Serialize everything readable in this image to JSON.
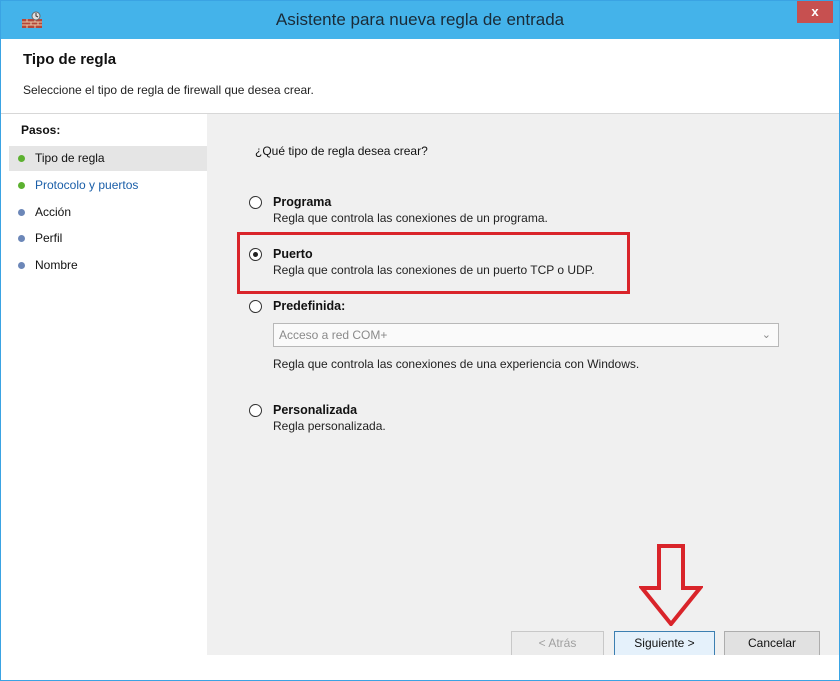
{
  "window": {
    "title": "Asistente para nueva regla de entrada",
    "close_label": "x",
    "app_icon": "firewall-wall-icon"
  },
  "header": {
    "title": "Tipo de regla",
    "subtitle": "Seleccione el tipo de regla de firewall que desea crear."
  },
  "steps": {
    "heading": "Pasos:",
    "items": [
      {
        "label": "Tipo de regla",
        "status": "green"
      },
      {
        "label": "Protocolo y puertos",
        "status": "green"
      },
      {
        "label": "Acción",
        "status": "blue"
      },
      {
        "label": "Perfil",
        "status": "blue"
      },
      {
        "label": "Nombre",
        "status": "blue"
      }
    ]
  },
  "content": {
    "question": "¿Qué tipo de regla desea crear?",
    "options": [
      {
        "title": "Programa",
        "description": "Regla que controla las conexiones de un programa.",
        "checked": false
      },
      {
        "title": "Puerto",
        "description": "Regla que controla las conexiones de un puerto TCP o UDP.",
        "checked": true
      },
      {
        "title": "Predefinida:",
        "description": "",
        "checked": false
      },
      {
        "title": "Personalizada",
        "description": "Regla personalizada.",
        "checked": false
      }
    ],
    "predefined_select": {
      "value": "Acceso a red COM+",
      "description": "Regla que controla las conexiones de una experiencia con Windows."
    }
  },
  "buttons": {
    "back": "< Atrás",
    "next": "Siguiente >",
    "cancel": "Cancelar"
  },
  "colors": {
    "titlebar": "#44b3ea",
    "highlight": "#d9242a",
    "step_done": "#5cb130",
    "step_pending": "#6c87b8"
  }
}
